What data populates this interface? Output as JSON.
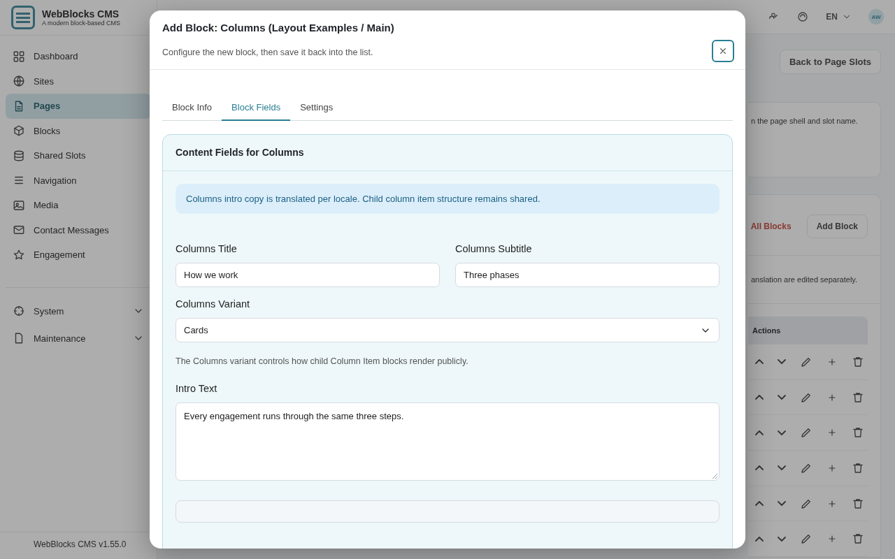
{
  "app": {
    "name": "WebBlocks CMS",
    "tagline": "A modern block-based CMS",
    "version": "WebBlocks CMS v1.55.0"
  },
  "sidebar": {
    "items": [
      {
        "label": "Dashboard",
        "selected": false
      },
      {
        "label": "Sites",
        "selected": false
      },
      {
        "label": "Pages",
        "selected": true
      },
      {
        "label": "Blocks",
        "selected": false
      },
      {
        "label": "Shared Slots",
        "selected": false
      },
      {
        "label": "Navigation",
        "selected": false
      },
      {
        "label": "Media",
        "selected": false
      },
      {
        "label": "Contact Messages",
        "selected": false
      },
      {
        "label": "Engagement",
        "selected": false
      }
    ],
    "groups": [
      {
        "label": "System",
        "expanded": false
      },
      {
        "label": "Maintenance",
        "expanded": false
      }
    ]
  },
  "header": {
    "language": "EN",
    "avatar": "AW"
  },
  "main": {
    "back_button": "Back to Page Slots",
    "note_1": "n the page shell and slot name.",
    "delete_link": "All Blocks",
    "add_button": "Add Block",
    "note_2": "anslation are edited separately.",
    "table": {
      "columns": [
        "Actions"
      ],
      "rows": [
        {
          "kind": "actions"
        },
        {
          "kind": "actions"
        },
        {
          "kind": "actions"
        },
        {
          "kind": "actions"
        },
        {
          "kind": "actions"
        },
        {
          "kind": "actions"
        }
      ]
    }
  },
  "modal": {
    "title": "Add Block: Columns (Layout Examples / Main)",
    "subtitle": "Configure the new block, then save it back into the list.",
    "tabs": [
      {
        "label": "Block Info",
        "selected": false
      },
      {
        "label": "Block Fields",
        "selected": true
      },
      {
        "label": "Settings",
        "selected": false
      }
    ],
    "panel": {
      "title": "Content Fields for Columns",
      "notice": "Columns intro copy is translated per locale. Child column item structure remains shared.",
      "fields": [
        {
          "kind": "text",
          "label": "Columns Title",
          "value": "How we work"
        },
        {
          "kind": "text",
          "label": "Columns Subtitle",
          "value": "Three phases"
        },
        {
          "kind": "select",
          "label": "Columns Variant",
          "value": "Cards",
          "help": "The Columns variant controls how child Column Item blocks render publicly."
        },
        {
          "kind": "textarea",
          "label": "Intro Text",
          "value": "Every engagement runs through the same three steps."
        }
      ]
    }
  }
}
